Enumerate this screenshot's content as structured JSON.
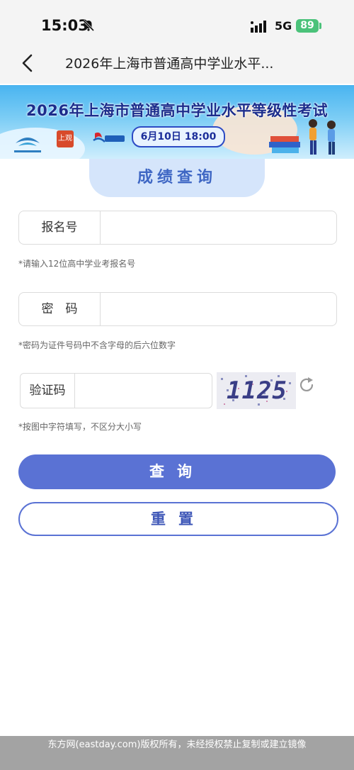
{
  "status_bar": {
    "time": "15:03",
    "network": "5G",
    "battery": "89"
  },
  "nav": {
    "title": "2026年上海市普通高中学业水平..."
  },
  "banner": {
    "title": "2026年上海市普通高中学业水平等级性考试",
    "date": "6月10日 18:00",
    "logo_b_text": "上观",
    "colors": {
      "title": "#1c2d8c",
      "sky": "#49b4f0"
    }
  },
  "tab": {
    "label": "成绩查询"
  },
  "form": {
    "registration": {
      "label": "报名号",
      "placeholder": "",
      "hint": "*请输入12位高中学业考报名号"
    },
    "password": {
      "label": "密　码",
      "placeholder": "",
      "hint": "*密码为证件号码中不含字母的后六位数字"
    },
    "captcha": {
      "label": "验证码",
      "placeholder": "",
      "image_text": "1125",
      "hint": "*按图中字符填写，不区分大小写"
    }
  },
  "buttons": {
    "query": "查询",
    "reset": "重置",
    "accent": "#5a72d4"
  },
  "footer": {
    "text": "东方网(eastday.com)版权所有，未经授权禁止复制或建立镜像"
  }
}
